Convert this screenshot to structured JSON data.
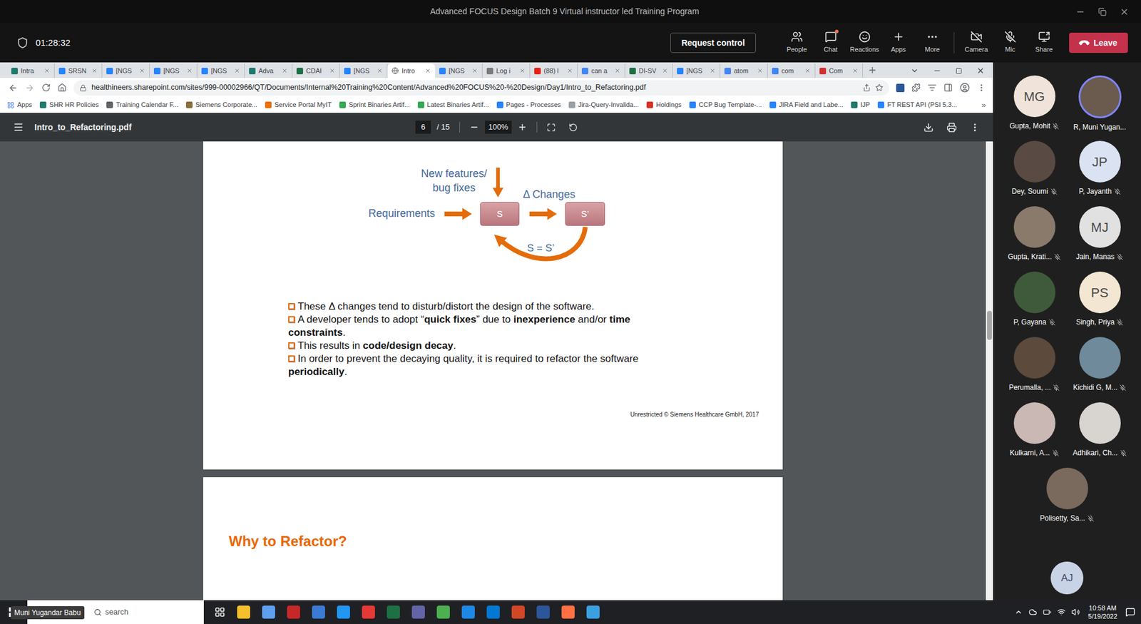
{
  "meeting": {
    "title": "Advanced FOCUS Design Batch 9 Virtual instructor led Training Program",
    "timer": "01:28:32",
    "request_control": "Request control",
    "controls": [
      {
        "kind": "people",
        "label": "People",
        "badge": false,
        "off": false
      },
      {
        "kind": "chat",
        "label": "Chat",
        "badge": true,
        "off": false
      },
      {
        "kind": "reactions",
        "label": "Reactions",
        "badge": false,
        "off": false
      },
      {
        "kind": "apps",
        "label": "Apps",
        "badge": false,
        "off": false
      },
      {
        "kind": "more",
        "label": "More",
        "badge": false,
        "off": false
      },
      {
        "kind": "camera",
        "label": "Camera",
        "badge": false,
        "off": true
      },
      {
        "kind": "mic",
        "label": "Mic",
        "badge": false,
        "off": true
      },
      {
        "kind": "share",
        "label": "Share",
        "badge": false,
        "off": false
      }
    ],
    "leave": "Leave"
  },
  "browser": {
    "tabs": [
      {
        "label": "Intra",
        "selected": false,
        "color": "#1f7a6e"
      },
      {
        "label": "SRSN",
        "selected": false,
        "color": "#2684ff"
      },
      {
        "label": "[NGS",
        "selected": false,
        "color": "#2684ff"
      },
      {
        "label": "[NGS",
        "selected": false,
        "color": "#2684ff"
      },
      {
        "label": "[NGS",
        "selected": false,
        "color": "#2684ff"
      },
      {
        "label": "Adva",
        "selected": false,
        "color": "#1f7a6e"
      },
      {
        "label": "CDAI",
        "selected": false,
        "color": "#1d7044"
      },
      {
        "label": "[NGS",
        "selected": false,
        "color": "#2684ff"
      },
      {
        "label": "Intro",
        "selected": true,
        "color": "#5f6368"
      },
      {
        "label": "[NGS",
        "selected": false,
        "color": "#2684ff"
      },
      {
        "label": "Log i",
        "selected": false,
        "color": "#7a7a7a"
      },
      {
        "label": "(88) l",
        "selected": false,
        "color": "#e62117"
      },
      {
        "label": "can a",
        "selected": false,
        "color": "#4285f4"
      },
      {
        "label": "DI-SV",
        "selected": false,
        "color": "#1d7044"
      },
      {
        "label": "[NGS",
        "selected": false,
        "color": "#2684ff"
      },
      {
        "label": "atom",
        "selected": false,
        "color": "#4285f4"
      },
      {
        "label": "com",
        "selected": false,
        "color": "#4285f4"
      },
      {
        "label": "Com",
        "selected": false,
        "color": "#d32f2f"
      }
    ],
    "url": "healthineers.sharepoint.com/sites/999-00002966/QT/Documents/Internal%20Training%20Content/Advanced%20FOCUS%20-%20Design/Day1/Intro_to_Refactoring.pdf",
    "bookmarks": [
      {
        "label": "Apps",
        "color": "#4285f4"
      },
      {
        "label": "SHR HR Policies",
        "color": "#1f7a6e"
      },
      {
        "label": "Training Calendar F...",
        "color": "#5f6368"
      },
      {
        "label": "Siemens Corporate...",
        "color": "#8a6d3b"
      },
      {
        "label": "Service Portal MyIT",
        "color": "#e8710a"
      },
      {
        "label": "Sprint Binaries Artif...",
        "color": "#34a853"
      },
      {
        "label": "Latest Binaries Artif...",
        "color": "#34a853"
      },
      {
        "label": "Pages - Processes",
        "color": "#2684ff"
      },
      {
        "label": "Jira-Query-Invalida...",
        "color": "#9aa0a6"
      },
      {
        "label": "Holdings",
        "color": "#d93025"
      },
      {
        "label": "CCP Bug Template-...",
        "color": "#2684ff"
      },
      {
        "label": "JIRA Field and Labe...",
        "color": "#2684ff"
      },
      {
        "label": "IJP",
        "color": "#1f7a6e"
      },
      {
        "label": "FT REST API (PSI 5.3...",
        "color": "#2684ff"
      }
    ],
    "bookmarks_more": "»"
  },
  "pdf_viewer": {
    "file_name": "Intro_to_Refactoring.pdf",
    "page": "6",
    "page_total": "/ 15",
    "zoom": "100%",
    "scroll_level": 0.39
  },
  "slide": {
    "diagram": {
      "top_input": [
        "New features/",
        "bug fixes"
      ],
      "left_input": "Requirements",
      "delta": "Δ Changes",
      "nodes": [
        "S",
        "S’"
      ],
      "loop": "S = S’"
    },
    "bullets": [
      [
        {
          "text": "These Δ changes tend to disturb/distort the design of the software.",
          "bold": false
        }
      ],
      [
        {
          "text": "A developer tends to adopt “",
          "bold": false
        },
        {
          "text": "quick fixes",
          "bold": true
        },
        {
          "text": "” due to ",
          "bold": false
        },
        {
          "text": "inexperience",
          "bold": true
        },
        {
          "text": " and/or ",
          "bold": false
        },
        {
          "text": "time constraints",
          "bold": true
        },
        {
          "text": ".",
          "bold": false
        }
      ],
      [
        {
          "text": "This results in ",
          "bold": false
        },
        {
          "text": "code/design decay",
          "bold": true
        },
        {
          "text": ".",
          "bold": false
        }
      ],
      [
        {
          "text": "In order to prevent the decaying quality, it is required to refactor the software ",
          "bold": false
        },
        {
          "text": "periodically",
          "bold": true
        },
        {
          "text": ".",
          "bold": false
        }
      ]
    ],
    "footer": "Unrestricted © Siemens Healthcare GmbH, 2017"
  },
  "next_slide": {
    "title": "Why to Refactor?"
  },
  "participants": [
    {
      "name": "Gupta, Mohit",
      "kind": "initials",
      "initials": "MG",
      "color": "#f0e4da",
      "muted": true,
      "speaking": false
    },
    {
      "name": "R, Muni Yugan...",
      "kind": "photo",
      "initials": "",
      "color": "#6b5a4e",
      "muted": false,
      "speaking": true
    },
    {
      "name": "Dey, Soumi",
      "kind": "photo",
      "initials": "",
      "color": "#5a4a44",
      "muted": true,
      "speaking": false
    },
    {
      "name": "P, Jayanth",
      "kind": "initials",
      "initials": "JP",
      "color": "#dbe3f3",
      "muted": true,
      "speaking": false
    },
    {
      "name": "Gupta, Krati...",
      "kind": "photo",
      "initials": "",
      "color": "#8a7a6c",
      "muted": true,
      "speaking": false
    },
    {
      "name": "Jain, Manas",
      "kind": "initials",
      "initials": "MJ",
      "color": "#e1e1e1",
      "muted": true,
      "speaking": false
    },
    {
      "name": "P, Gayana",
      "kind": "photo",
      "initials": "",
      "color": "#3f5a3a",
      "muted": true,
      "speaking": false
    },
    {
      "name": "Singh, Priya",
      "kind": "initials",
      "initials": "PS",
      "color": "#f3e6d3",
      "muted": true,
      "speaking": false
    },
    {
      "name": "Perumalla, ...",
      "kind": "photo",
      "initials": "",
      "color": "#5c4a3c",
      "muted": true,
      "speaking": false
    },
    {
      "name": "Kichidi G, M...",
      "kind": "photo",
      "initials": "",
      "color": "#6f8a9a",
      "muted": true,
      "speaking": false
    },
    {
      "name": "Kulkarni, A...",
      "kind": "photo",
      "initials": "",
      "color": "#c9b8b4",
      "muted": true,
      "speaking": false
    },
    {
      "name": "Adhikari, Ch...",
      "kind": "photo",
      "initials": "",
      "color": "#d8d4d0",
      "muted": true,
      "speaking": false
    },
    {
      "name": "Polisetty, Sa...",
      "kind": "photo",
      "initials": "",
      "color": "#7a6a5e",
      "muted": true,
      "speaking": false
    }
  ],
  "extra_participant": {
    "initials": "AJ",
    "color": "#c9d3e6"
  },
  "taskbar": {
    "presenter": "Muni Yugandar Babu",
    "search": "search",
    "time": "10:58 AM",
    "date": "5/19/2022"
  }
}
